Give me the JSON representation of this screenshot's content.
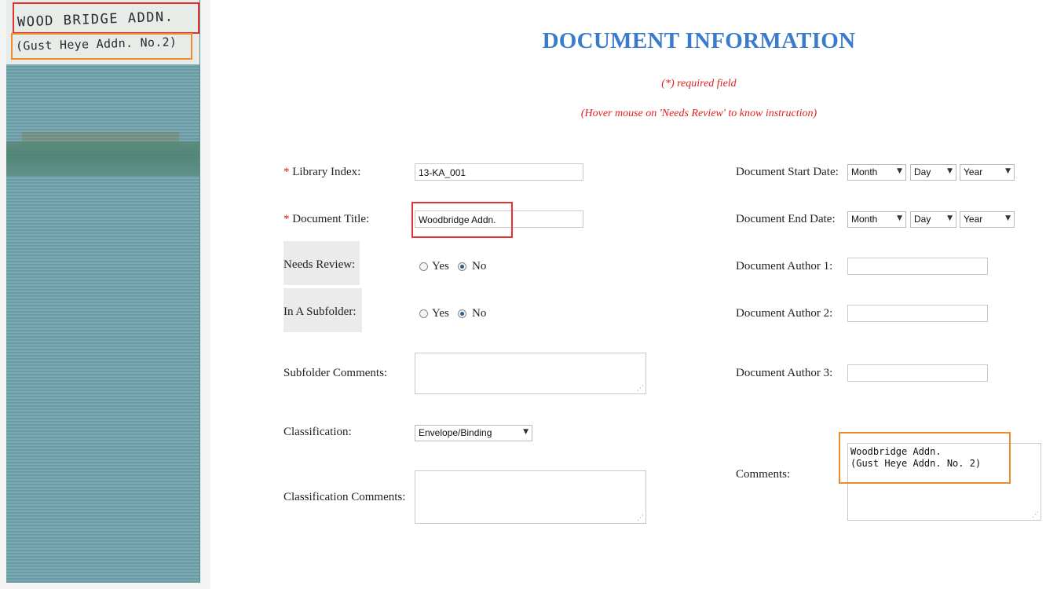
{
  "scan": {
    "line1": "WOOD BRIDGE  ADDN.",
    "line2": "(Gust Heye Addn. No.2)"
  },
  "header": {
    "title": "DOCUMENT INFORMATION",
    "required_note": "(*) required field",
    "hover_note": "(Hover mouse on 'Needs Review' to know instruction)"
  },
  "form": {
    "required_mark": "*",
    "library_index": {
      "label": "Library Index:",
      "value": "13-KA_001"
    },
    "document_title": {
      "label": "Document Title:",
      "value": "Woodbridge Addn."
    },
    "needs_review": {
      "label": "Needs Review:",
      "yes": "Yes",
      "no": "No",
      "selected": "No"
    },
    "in_subfolder": {
      "label": "In A Subfolder:",
      "yes": "Yes",
      "no": "No",
      "selected": "No"
    },
    "subfolder_comments": {
      "label": "Subfolder Comments:"
    },
    "classification": {
      "label": "Classification:",
      "value": "Envelope/Binding"
    },
    "classification_comments": {
      "label": "Classification Comments:"
    },
    "start_date": {
      "label": "Document Start Date:",
      "month": "Month",
      "day": "Day",
      "year": "Year"
    },
    "end_date": {
      "label": "Document End Date:",
      "month": "Month",
      "day": "Day",
      "year": "Year"
    },
    "author1": {
      "label": "Document Author 1:"
    },
    "author2": {
      "label": "Document Author 2:"
    },
    "author3": {
      "label": "Document Author 3:"
    },
    "comments": {
      "label": "Comments:",
      "value": "Woodbridge Addn.\n(Gust Heye Addn. No. 2)"
    }
  },
  "colors": {
    "title": "#3a7cc9",
    "note": "#e02020",
    "highlight_red": "#e53030",
    "highlight_orange": "#f08a2e"
  }
}
